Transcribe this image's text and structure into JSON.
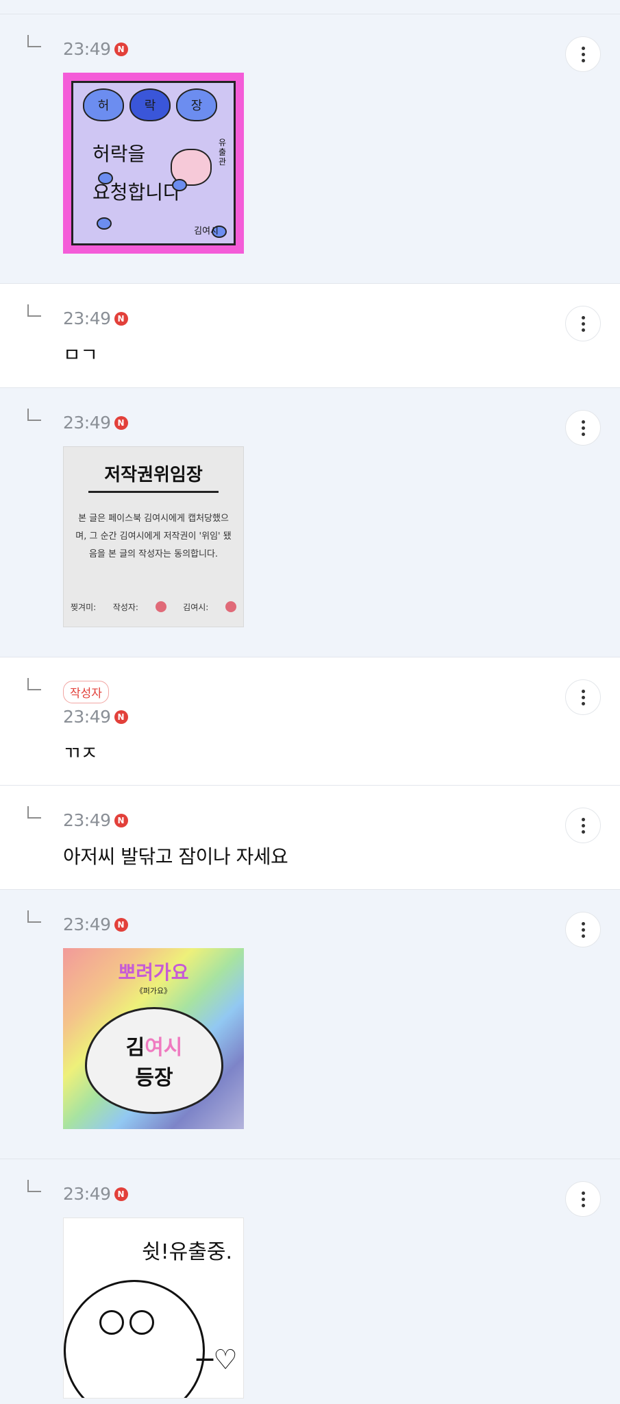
{
  "replies": [
    {
      "time": "23:49",
      "badge": "N",
      "kind": "sticker"
    },
    {
      "time": "23:49",
      "badge": "N",
      "kind": "text",
      "text": "ㅁㄱ"
    },
    {
      "time": "23:49",
      "badge": "N",
      "kind": "sticker"
    },
    {
      "time": "23:49",
      "badge": "N",
      "kind": "text",
      "text": "ㄲㅈ",
      "author_tag": "작성자"
    },
    {
      "time": "23:49",
      "badge": "N",
      "kind": "text",
      "text": "아저씨 발닦고 잠이나 자세요"
    },
    {
      "time": "23:49",
      "badge": "N",
      "kind": "sticker"
    },
    {
      "time": "23:49",
      "badge": "N",
      "kind": "sticker"
    }
  ],
  "sticker1": {
    "hearts": [
      "허",
      "락",
      "장"
    ],
    "line1": "허락을",
    "line2": "요청합니다",
    "signature": "김여시",
    "side_text": "유출관"
  },
  "sticker2": {
    "title": "저작권위임장",
    "body": "본 글은 페이스북 김여시에게 캡처당했으며, 그 순간 김여시에게 저작권이 '위임' 됐음을 본 글의 작성자는 동의합니다.",
    "foot_left": "찢겨미:",
    "foot_mid": "작성자:",
    "foot_right": "김여시:"
  },
  "sticker3": {
    "banner": "뽀려가요",
    "sub": "《퍼가요》",
    "name_a": "김",
    "name_b": "여시",
    "line2": "등장"
  },
  "sticker4": {
    "caption": "쉿!유출중."
  },
  "colors": {
    "badge": "#e2403a",
    "blue_bg": "#f0f4fa",
    "white_bg": "#ffffff"
  }
}
